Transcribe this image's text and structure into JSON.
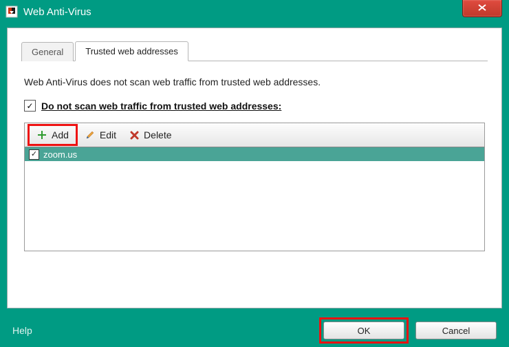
{
  "window": {
    "title": "Web Anti-Virus"
  },
  "tabs": {
    "general": "General",
    "trusted": "Trusted web addresses"
  },
  "description": "Web Anti-Virus does not scan web traffic from trusted web addresses.",
  "optionLabel": "Do not scan web traffic from trusted web addresses:",
  "toolbar": {
    "add": "Add",
    "edit": "Edit",
    "delete": "Delete"
  },
  "list": {
    "items": [
      {
        "label": "zoom.us",
        "checked": true
      }
    ]
  },
  "footer": {
    "help": "Help",
    "ok": "OK",
    "cancel": "Cancel"
  }
}
